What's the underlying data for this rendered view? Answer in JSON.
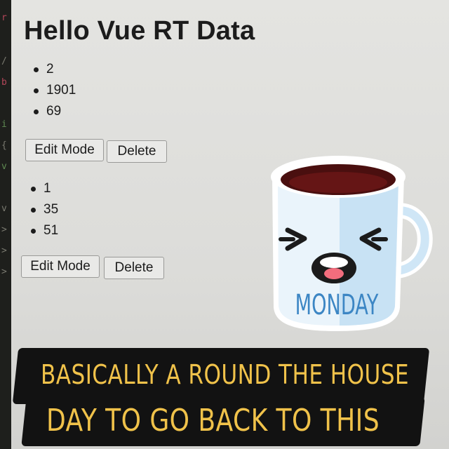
{
  "page": {
    "title": "Hello Vue RT Data"
  },
  "groups": [
    {
      "items": [
        "2",
        "1901",
        "69"
      ],
      "edit_label": "Edit Mode",
      "delete_label": "Delete"
    },
    {
      "items": [
        "1",
        "35",
        "51"
      ],
      "edit_label": "Edit Mode",
      "delete_label": "Delete"
    }
  ],
  "sticker": {
    "icon": "coffee-mug-icon",
    "label": "MONDAY",
    "label_color": "#3c86c4"
  },
  "caption": {
    "line1": "BASICALLY A ROUND THE HOUSE",
    "line2": "DAY TO GO BACK TO THIS",
    "color": "#f0c24a"
  }
}
